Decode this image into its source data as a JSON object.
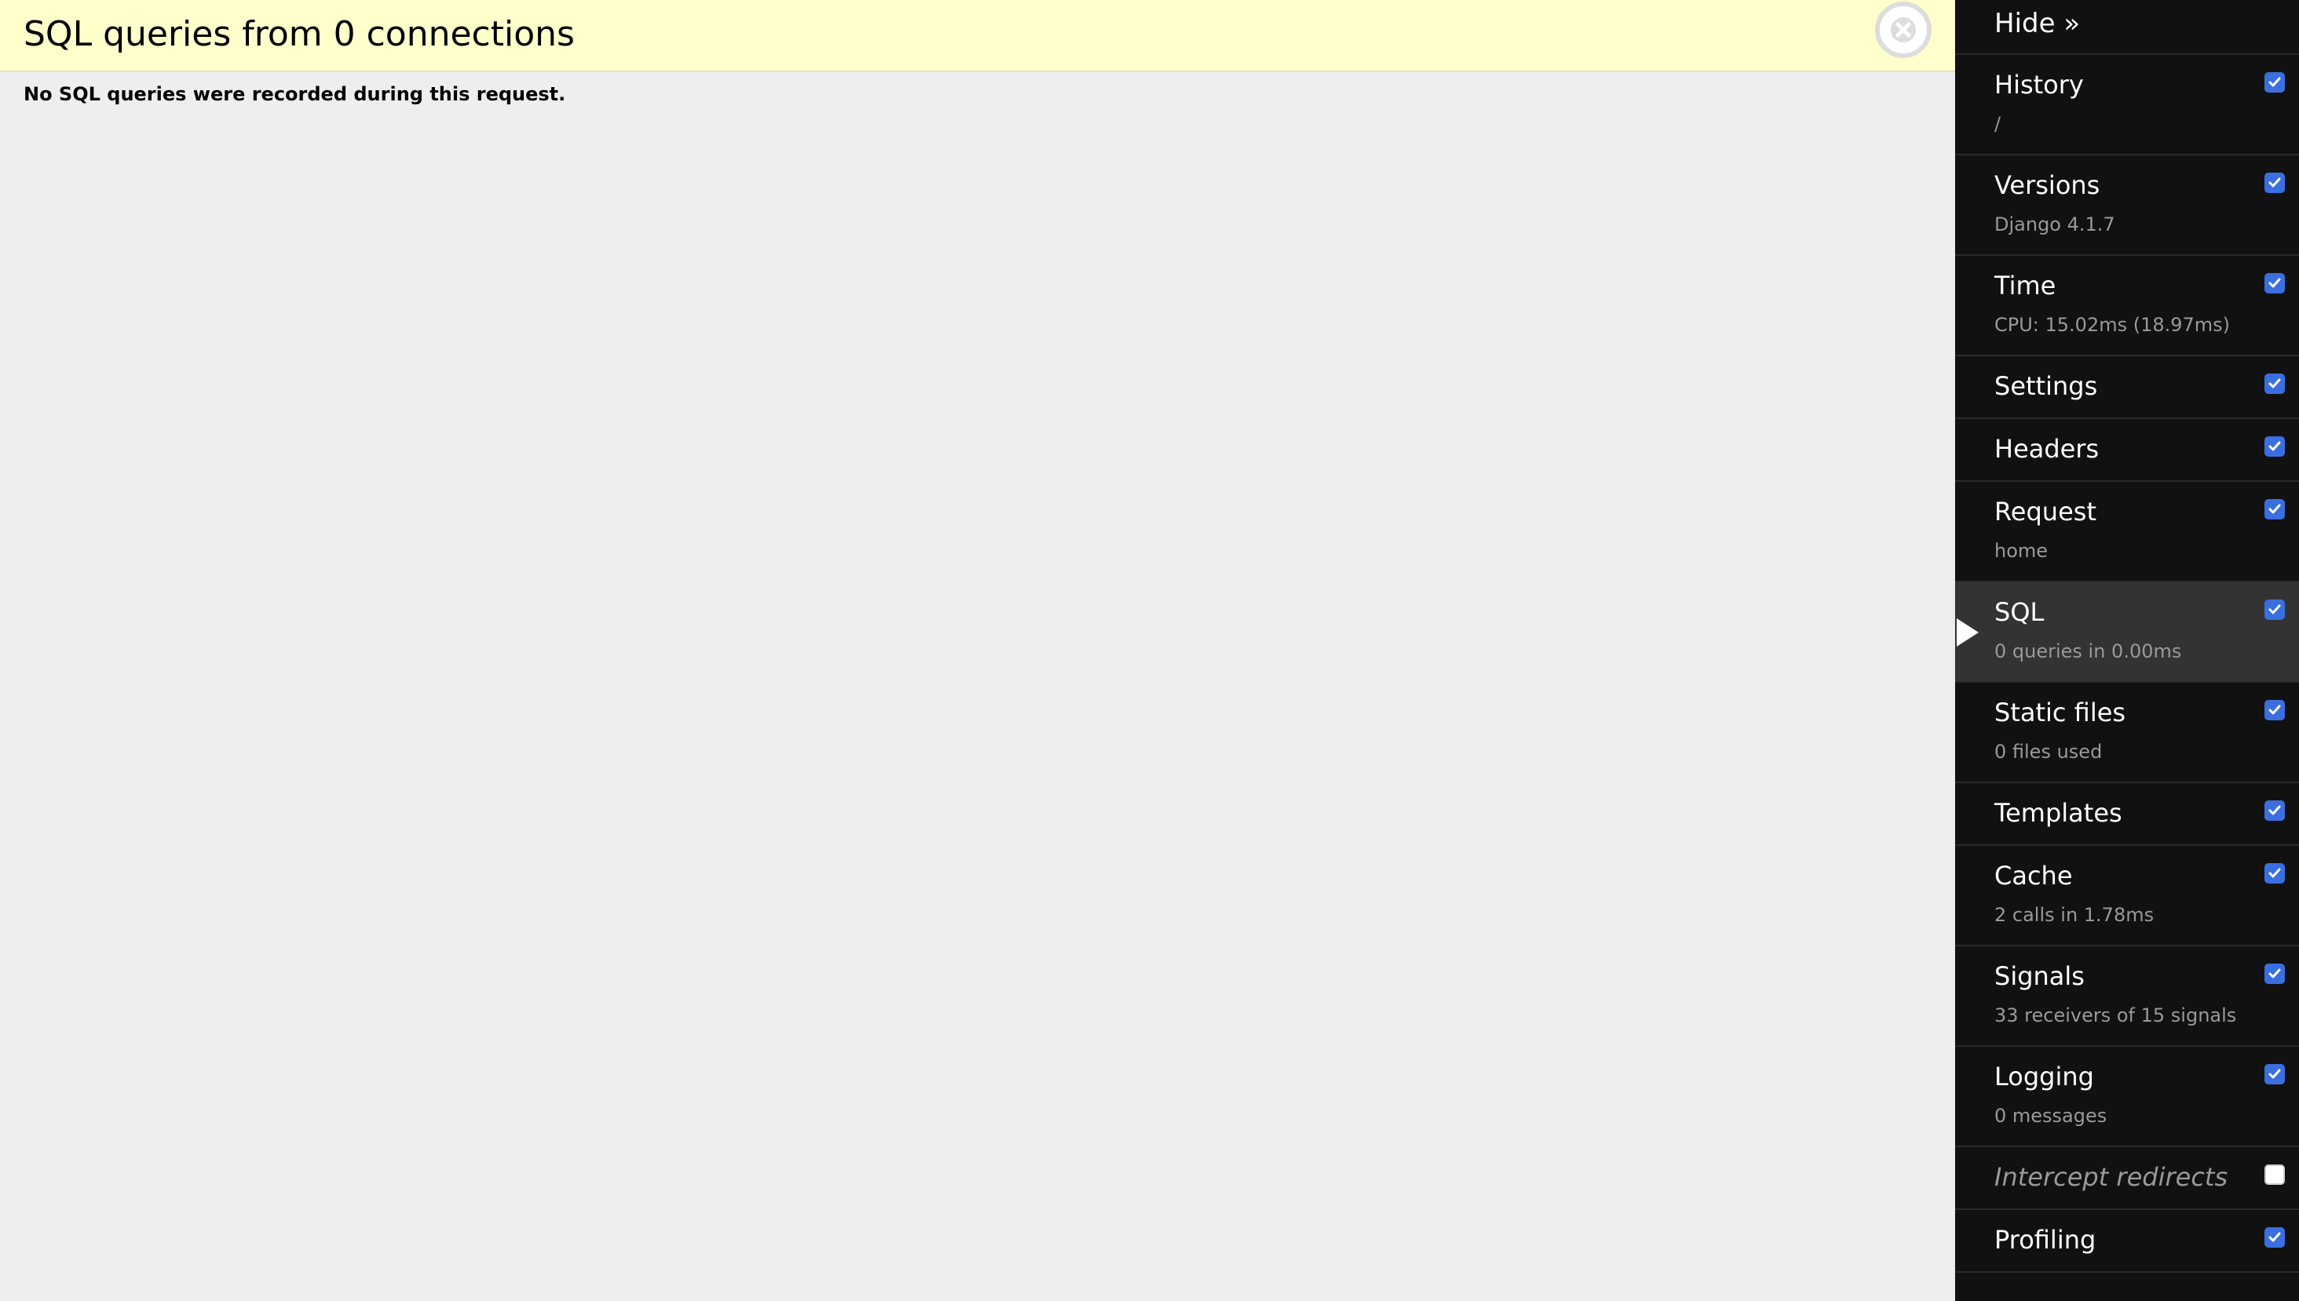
{
  "panel": {
    "title": "SQL queries from 0 connections",
    "message": "No SQL queries were recorded during this request.",
    "close_icon": "close-circle-icon"
  },
  "toolbar": {
    "hide_label": "Hide »",
    "items": [
      {
        "title": "History",
        "subtitle": "/",
        "checked": true
      },
      {
        "title": "Versions",
        "subtitle": "Django 4.1.7",
        "checked": true
      },
      {
        "title": "Time",
        "subtitle": "CPU: 15.02ms (18.97ms)",
        "checked": true
      },
      {
        "title": "Settings",
        "subtitle": "",
        "checked": true
      },
      {
        "title": "Headers",
        "subtitle": "",
        "checked": true
      },
      {
        "title": "Request",
        "subtitle": "home",
        "checked": true
      },
      {
        "title": "SQL",
        "subtitle": "0 queries in 0.00ms",
        "checked": true,
        "active": true
      },
      {
        "title": "Static files",
        "subtitle": "0 files used",
        "checked": true
      },
      {
        "title": "Templates",
        "subtitle": "",
        "checked": true
      },
      {
        "title": "Cache",
        "subtitle": "2 calls in 1.78ms",
        "checked": true
      },
      {
        "title": "Signals",
        "subtitle": "33 receivers of 15 signals",
        "checked": true
      },
      {
        "title": "Logging",
        "subtitle": "0 messages",
        "checked": true
      },
      {
        "title": "Intercept redirects",
        "subtitle": "",
        "checked": false,
        "muted": true
      },
      {
        "title": "Profiling",
        "subtitle": "",
        "checked": true
      }
    ]
  },
  "colors": {
    "header_bg": "#ffffcc",
    "panel_bg": "#eeeeee",
    "toolbar_bg": "#111111",
    "active_bg": "#333333",
    "checkbox": "#3b6fe0"
  }
}
